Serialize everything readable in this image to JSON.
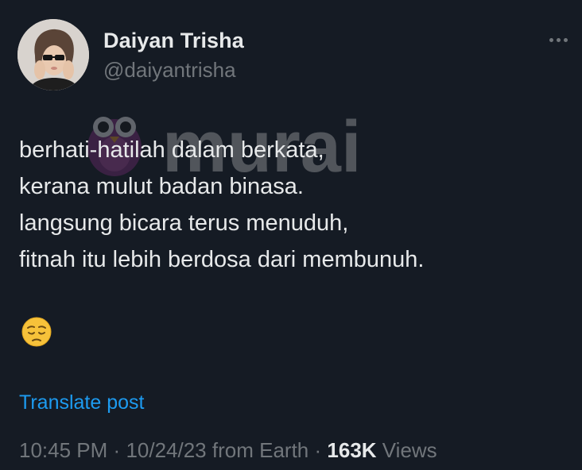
{
  "author": {
    "display_name": "Daiyan Trisha",
    "handle": "@daiyantrisha",
    "avatar_icon": "profile-photo"
  },
  "header": {
    "more_icon": "more-options-icon"
  },
  "watermark": {
    "brand_text": "murai",
    "logo_icon": "owl-logo"
  },
  "post": {
    "lines": [
      "berhati-hatilah dalam berkata,",
      "kerana mulut badan binasa.",
      "langsung bicara terus menuduh,",
      "fitnah itu lebih berdosa dari membunuh."
    ],
    "emoji": "pensive-face-emoji"
  },
  "translate_label": "Translate post",
  "meta": {
    "time": "10:45 PM",
    "separator": "·",
    "date": "10/24/23",
    "location": "from Earth",
    "views_count": "163K",
    "views_label": "Views"
  },
  "colors": {
    "background": "#151b24",
    "text": "#e7e9ea",
    "muted": "#71767b",
    "link": "#1d9bf0"
  }
}
